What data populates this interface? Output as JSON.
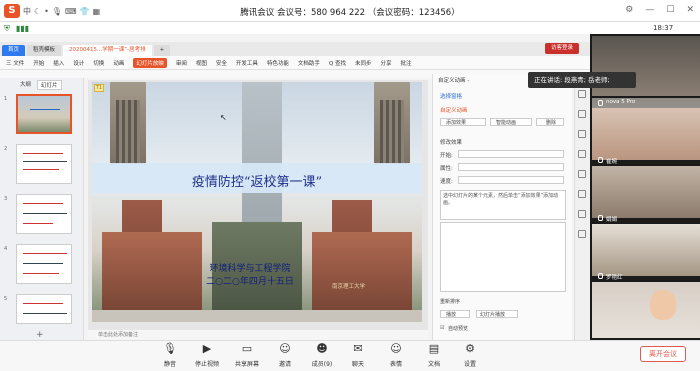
{
  "ime": {
    "logo": "S",
    "mode": "中",
    "icons": [
      "moon-icon",
      "dot-icon",
      "mic-icon",
      "keyboard-icon",
      "shirt-icon",
      "grid-icon"
    ]
  },
  "meeting": {
    "title": "腾讯会议 会议号：580 964 222  （会议密码：123456）"
  },
  "clock": "18:37",
  "wps": {
    "tabs": [
      {
        "label": "首页",
        "kind": "home"
      },
      {
        "label": "稻壳模板",
        "kind": "normal"
      },
      {
        "label": "20200415...学期一课”-居考排",
        "kind": "active"
      }
    ],
    "login_label": "访客登录",
    "menu": [
      "三 文件",
      "开始",
      "插入",
      "设计",
      "切换",
      "动画",
      "幻灯片放映",
      "审阅",
      "视图",
      "安全",
      "开发工具",
      "特色功能",
      "文档助手",
      "Q 查找",
      "未同步",
      "分享",
      "批注"
    ],
    "menu_selected": "幻灯片放映"
  },
  "leftpanel": {
    "tabs": [
      "大纲",
      "幻灯片"
    ]
  },
  "slide": {
    "title": "疫情防控“返校第一课”",
    "subtitle_line1": "环境科学与工程学院",
    "subtitle_line2": "二○二○年四月十五日",
    "gate_text": "南京理工大学"
  },
  "notes_placeholder": "单击此处添加备注",
  "rightpanel": {
    "header": "自定义动画 -",
    "select_pane": "选择窗格",
    "section": "自定义动画",
    "add_effect": "添加效果",
    "smart_anim": "智能动画",
    "delete": "删除",
    "modify_effect": "修改效果",
    "start_label": "开始:",
    "property_label": "属性:",
    "speed_label": "速度:",
    "hint": "选中幻灯片的某个元素，然后单击“添加效果”添加动画。",
    "reorder": "重新排序",
    "play": "播放",
    "slideshow": "幻灯片播放",
    "autopreview": "自动预览"
  },
  "video": {
    "speaking": "正在讲话: 段燕青; 岳老师;",
    "participants": [
      "nova 5 Pro",
      "崔婉",
      "娟娟",
      "罗艳红",
      ""
    ]
  },
  "bottombar": {
    "buttons": [
      {
        "label": "静音",
        "icon": "microphone-icon"
      },
      {
        "label": "停止视频",
        "icon": "video-camera-icon"
      },
      {
        "label": "共享屏幕",
        "icon": "share-screen-icon"
      },
      {
        "label": "邀请",
        "icon": "add-user-icon"
      },
      {
        "label": "成员(9)",
        "icon": "members-icon"
      },
      {
        "label": "聊天",
        "icon": "chat-icon"
      },
      {
        "label": "表情",
        "icon": "emoji-icon"
      },
      {
        "label": "文档",
        "icon": "document-icon"
      },
      {
        "label": "设置",
        "icon": "settings-icon"
      }
    ],
    "leave": "离开会议"
  },
  "colors": {
    "accent": "#e8542a",
    "slide_title": "#1e2f8a",
    "leave": "#e05a4f",
    "video_bg": "#1b1b1b"
  }
}
